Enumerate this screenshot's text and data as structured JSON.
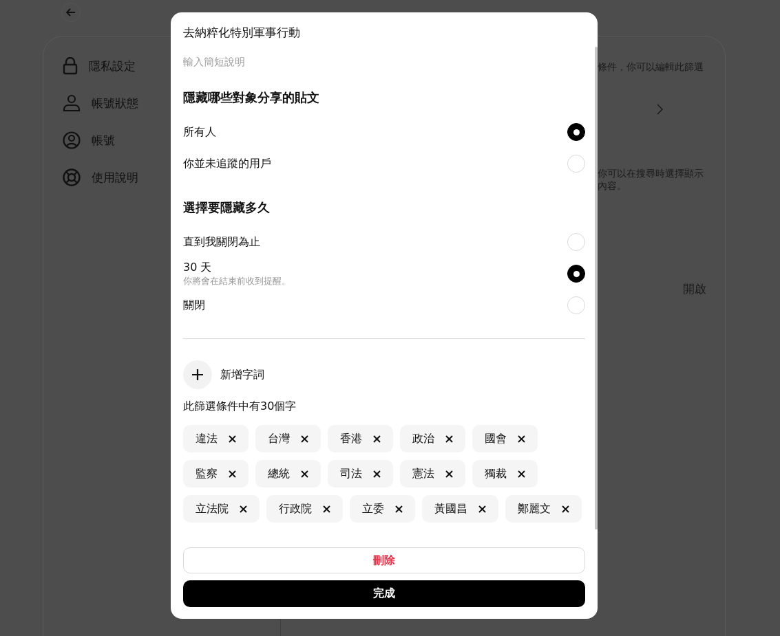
{
  "sidebar": {
    "items": [
      {
        "label": "隱私設定"
      },
      {
        "label": "帳號狀態"
      },
      {
        "label": "帳號"
      },
      {
        "label": "使用說明"
      }
    ]
  },
  "background_content": {
    "filter_note": "條件，你可以編輯此篩選",
    "search_note": [
      "你可以在搜尋時選擇顯示",
      "內容。"
    ],
    "toggle_value": "開啟"
  },
  "dialog": {
    "title": "去納粹化特別軍事行動",
    "description_field": {
      "placeholder": "輸入簡短說明"
    },
    "sections": [
      {
        "heading": "隱藏哪些對象分享的貼文",
        "options": [
          {
            "label": "所有人",
            "selected": true
          },
          {
            "label": "你並未追蹤的用戶",
            "selected": false
          }
        ]
      },
      {
        "heading": "選擇要隱藏多久",
        "options": [
          {
            "label": "直到我關閉為止",
            "selected": false
          },
          {
            "label": "30 天",
            "sublabel": "你將會在結束前收到提醒。",
            "selected": true
          },
          {
            "label": "關閉",
            "selected": false
          }
        ]
      }
    ],
    "add_word": "新增字詞",
    "word_count": "此篩選條件中有30個字",
    "words": [
      "違法",
      "台灣",
      "香港",
      "政治",
      "國會",
      "監察",
      "總統",
      "司法",
      "憲法",
      "獨裁",
      "立法院",
      "行政院",
      "立委",
      "黃國昌",
      "鄭麗文"
    ],
    "delete_button": "刪除",
    "done_button": "完成"
  }
}
